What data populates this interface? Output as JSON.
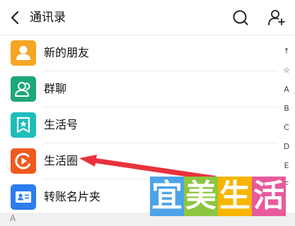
{
  "header": {
    "title": "通讯录",
    "back_icon": "chevron-left-icon",
    "search_icon": "search-icon",
    "add_user_icon": "add-user-icon"
  },
  "list": {
    "items": [
      {
        "label": "新的朋友",
        "icon": "person-icon",
        "color": "#F5A623"
      },
      {
        "label": "群聊",
        "icon": "group-chat-icon",
        "color": "#1FA67A"
      },
      {
        "label": "生活号",
        "icon": "bookmark-star-icon",
        "color": "#1FBDBA"
      },
      {
        "label": "生活圈",
        "icon": "life-circle-icon",
        "color": "#F05A1E"
      },
      {
        "label": "转账名片夹",
        "icon": "business-card-icon",
        "color": "#2D7CF0"
      }
    ],
    "section_letter": "A"
  },
  "index_bar": [
    "↑",
    "☆",
    "A",
    "B",
    "C",
    "D",
    "E",
    "F"
  ],
  "watermark": {
    "chars": [
      "宜",
      "美",
      "生",
      "活"
    ],
    "colors": [
      "#4DA3E8",
      "#8CC63F",
      "#F7B500",
      "#E85A9B"
    ]
  },
  "accent_arrow_color": "#E8323C"
}
